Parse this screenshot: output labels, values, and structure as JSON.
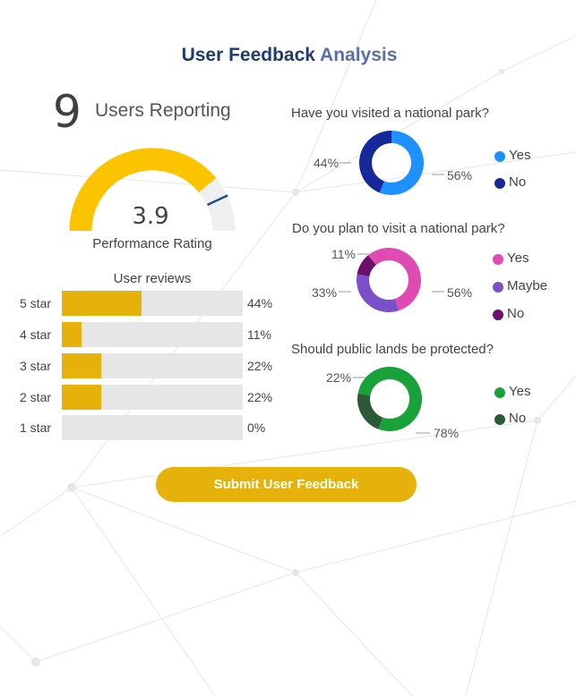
{
  "header": {
    "title_part1": "User Feedback",
    "title_part2": "Analysis"
  },
  "summary": {
    "users_count": "9",
    "users_label": "Users Reporting"
  },
  "gauge": {
    "value": 3.9,
    "value_text": "3.9",
    "min": 0,
    "max": 5,
    "target": 4.3,
    "label": "Performance Rating"
  },
  "reviews": {
    "title": "User reviews",
    "rows": [
      {
        "label": "5 star",
        "value": 44,
        "pct": "44%"
      },
      {
        "label": "4 star",
        "value": 11,
        "pct": "11%"
      },
      {
        "label": "3 star",
        "value": 22,
        "pct": "22%"
      },
      {
        "label": "2 star",
        "value": 22,
        "pct": "22%"
      },
      {
        "label": "1 star",
        "value": 0,
        "pct": "0%"
      }
    ]
  },
  "chart_data": [
    {
      "type": "pie",
      "title": "Have you visited a national park?",
      "categories": [
        "Yes",
        "No"
      ],
      "values": [
        56,
        44
      ],
      "labels": [
        "56%",
        "44%"
      ]
    },
    {
      "type": "pie",
      "title": "Do you plan to visit a national park?",
      "categories": [
        "Yes",
        "Maybe",
        "No"
      ],
      "values": [
        56,
        33,
        11
      ],
      "labels": [
        "56%",
        "33%",
        "11%"
      ]
    },
    {
      "type": "pie",
      "title": "Should public lands be protected?",
      "categories": [
        "Yes",
        "No"
      ],
      "values": [
        78,
        22
      ],
      "labels": [
        "78%",
        "22%"
      ]
    }
  ],
  "colors": {
    "accent": "#e6b10a",
    "gauge_fill": "#fcc300",
    "gauge_track": "#efefef",
    "gauge_target": "#1f4e8c",
    "q1": [
      "#1e90ff",
      "#16289a"
    ],
    "q2": [
      "#e04bb3",
      "#7b4fc8",
      "#6c0f6e"
    ],
    "q3": [
      "#19a23a",
      "#2d5a36"
    ]
  },
  "actions": {
    "submit_label": "Submit User Feedback"
  }
}
